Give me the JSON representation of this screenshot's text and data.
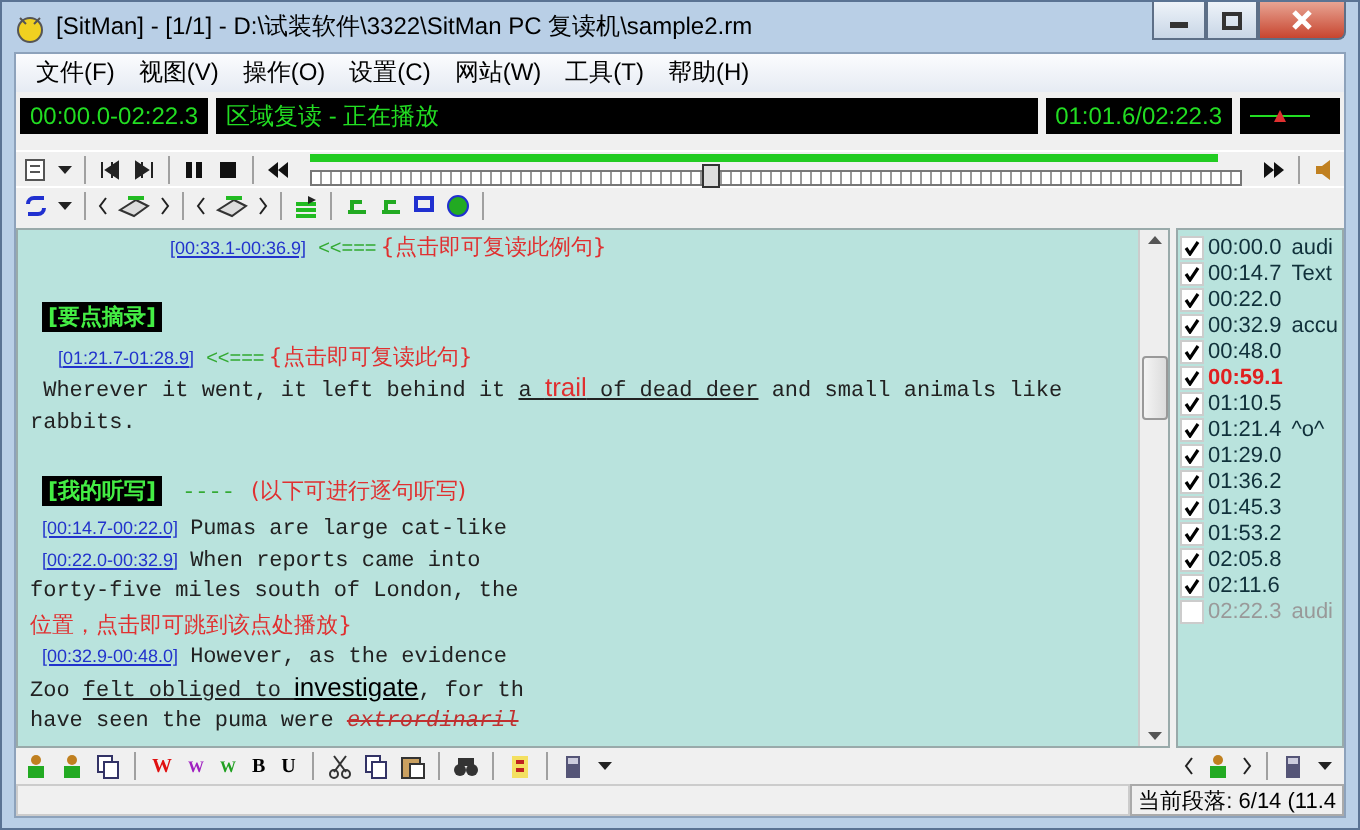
{
  "window": {
    "title": "[SitMan] - [1/1] - D:\\试装软件\\3322\\SitMan PC 复读机\\sample2.rm"
  },
  "menu": [
    "文件(F)",
    "视图(V)",
    "操作(O)",
    "设置(C)",
    "网站(W)",
    "工具(T)",
    "帮助(H)"
  ],
  "display": {
    "range": "00:00.0-02:22.3",
    "status": "区域复读 - 正在播放",
    "position": "01:01.6/02:22.3"
  },
  "player": {
    "level": 0.43
  },
  "document": [
    {
      "kind": "link-note",
      "time": "[00:33.1-00:36.9]",
      "arrow": "<<===",
      "note": "{点击即可复读此例句}",
      "indent": true
    },
    {
      "kind": "gap"
    },
    {
      "kind": "heading",
      "label": "[要点摘录]"
    },
    {
      "kind": "link-note",
      "time": "[01:21.7-01:28.9]",
      "arrow": "<<===",
      "note": "{点击即可复读此句}",
      "indent": false
    },
    {
      "kind": "runs",
      "runs": [
        {
          "kind": "plain",
          "text": " Wherever it went, it left behind it "
        },
        {
          "kind": "underline",
          "text": "a "
        },
        {
          "kind": "keyword",
          "text": "trail"
        },
        {
          "kind": "underline",
          "text": " of dead deer"
        },
        {
          "kind": "plain",
          "text": " and small animals like rabbits."
        }
      ]
    },
    {
      "kind": "gap"
    },
    {
      "kind": "heading",
      "label": "[我的听写]",
      "dashes": "----",
      "note": "(以下可进行逐句听写)"
    },
    {
      "kind": "segment",
      "time": "[00:14.7-00:22.0]",
      "text": "Pumas are large cat-like"
    },
    {
      "kind": "segment",
      "time": "[00:22.0-00:32.9]",
      "text": "When reports came into"
    },
    {
      "kind": "runs",
      "runs": [
        {
          "kind": "plain",
          "text": "forty-five miles south of London, the"
        }
      ]
    },
    {
      "kind": "runs",
      "runs": [
        {
          "kind": "note",
          "text": "位置，点击即可跳到该点处播放}"
        }
      ]
    },
    {
      "kind": "segment",
      "time": "[00:32.9-00:48.0]",
      "text": "However, as the evidence"
    },
    {
      "kind": "runs",
      "runs": [
        {
          "kind": "plain",
          "text": "Zoo "
        },
        {
          "kind": "underline",
          "text": "felt obliged to "
        },
        {
          "kind": "keyword-dark",
          "text": "investigate"
        },
        {
          "kind": "plain",
          "text": ", for th"
        }
      ]
    },
    {
      "kind": "runs",
      "runs": [
        {
          "kind": "plain",
          "text": "have seen the puma were "
        },
        {
          "kind": "strike",
          "text": "extrordinaril"
        }
      ]
    }
  ],
  "format_buttons": [
    {
      "label": "W",
      "color": "#e01010"
    },
    {
      "label": "W",
      "color": "#a020c0"
    },
    {
      "label": "W",
      "color": "#20a020"
    },
    {
      "label": "B",
      "color": "#000000"
    },
    {
      "label": "U",
      "color": "#000000"
    }
  ],
  "segments": [
    {
      "time": "00:00.0",
      "note": "audi",
      "checked": true,
      "selected": false
    },
    {
      "time": "00:14.7",
      "note": "Text",
      "checked": true,
      "selected": false
    },
    {
      "time": "00:22.0",
      "checked": true,
      "selected": false
    },
    {
      "time": "00:32.9",
      "note": "accu",
      "checked": true,
      "selected": false
    },
    {
      "time": "00:48.0",
      "checked": true,
      "selected": false
    },
    {
      "time": "00:59.1",
      "checked": true,
      "selected": true
    },
    {
      "time": "01:10.5",
      "checked": true,
      "selected": false
    },
    {
      "time": "01:21.4",
      "note": "^o^",
      "checked": true,
      "selected": false
    },
    {
      "time": "01:29.0",
      "checked": true,
      "selected": false
    },
    {
      "time": "01:36.2",
      "checked": true,
      "selected": false
    },
    {
      "time": "01:45.3",
      "checked": true,
      "selected": false
    },
    {
      "time": "01:53.2",
      "checked": true,
      "selected": false
    },
    {
      "time": "02:05.8",
      "checked": true,
      "selected": false
    },
    {
      "time": "02:11.6",
      "checked": true,
      "selected": false
    },
    {
      "time": "02:22.3",
      "note": "audi",
      "checked": false,
      "selected": false
    }
  ],
  "status_bar": {
    "text": "当前段落: 6/14 (11.4"
  }
}
